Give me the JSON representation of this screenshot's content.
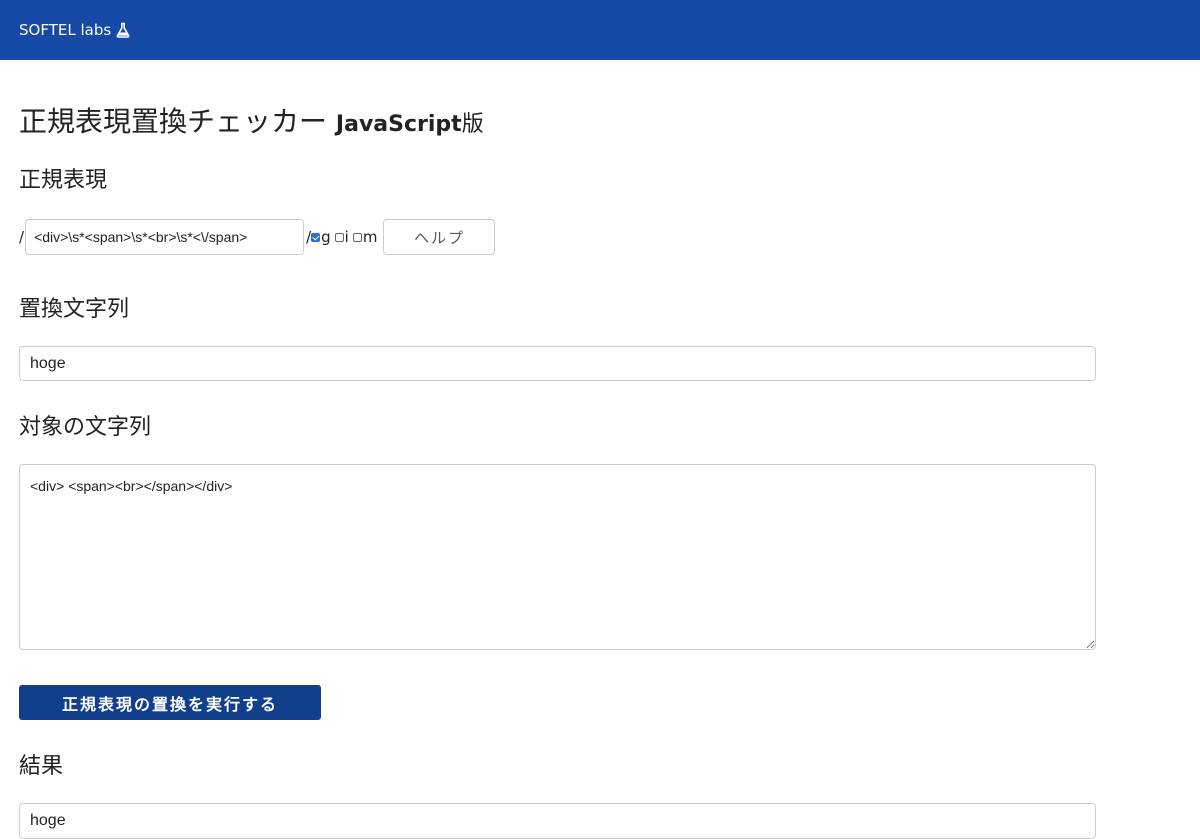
{
  "header": {
    "brand": "SOFTEL labs",
    "brand_icon": "flask-icon",
    "background_color": "#1749a6"
  },
  "title": {
    "main": "正規表現置換チェッカー",
    "sub": "JavaScript",
    "suffix": "版"
  },
  "regex_section": {
    "heading": "正規表現",
    "open_slash": "/",
    "close_slash": "/",
    "pattern_value": "<div>\\s*<span>\\s*<br>\\s*<\\/span>",
    "flags": [
      {
        "label": "g",
        "checked": true
      },
      {
        "label": "i",
        "checked": false
      },
      {
        "label": "m",
        "checked": false
      }
    ],
    "help_label": "ヘルプ"
  },
  "replacement_section": {
    "heading": "置換文字列",
    "value": "hoge"
  },
  "target_section": {
    "heading": "対象の文字列",
    "value": "<div> <span><br></span></div>"
  },
  "run_button": {
    "label": "正規表現の置換を実行する",
    "color": "#123f8c"
  },
  "result_section": {
    "heading": "結果",
    "value": "hoge"
  }
}
